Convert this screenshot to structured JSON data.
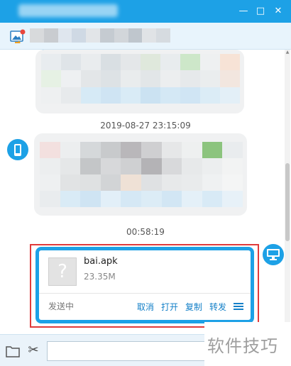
{
  "window": {
    "controls": {
      "minimize": "—",
      "maximize": "□",
      "close": "✕"
    }
  },
  "contact_bar": {
    "icon": "send-image-icon"
  },
  "chat": {
    "messages": [
      {
        "type": "image",
        "sender": "phone",
        "timestamp": ""
      },
      {
        "type": "timestamp",
        "text": "2019-08-27 23:15:09"
      },
      {
        "type": "image",
        "sender": "phone"
      },
      {
        "type": "timestamp",
        "text": "00:58:19"
      },
      {
        "type": "file",
        "sender": "pc"
      }
    ],
    "timestamp_1": "2019-08-27 23:15:09",
    "timestamp_2": "00:58:19",
    "file": {
      "thumb_glyph": "?",
      "name": "bai.apk",
      "size": "23.35M",
      "status": "发送中",
      "actions": {
        "cancel": "取消",
        "open": "打开",
        "copy": "复制",
        "forward": "转发"
      }
    }
  },
  "toolbar": {
    "input_placeholder": "",
    "icons": [
      "folder-icon",
      "scissors-icon"
    ]
  },
  "watermark": {
    "text": "软件技巧"
  },
  "colors": {
    "accent": "#1da1e6",
    "highlight": "#e03a3a",
    "link": "#1480c8"
  }
}
